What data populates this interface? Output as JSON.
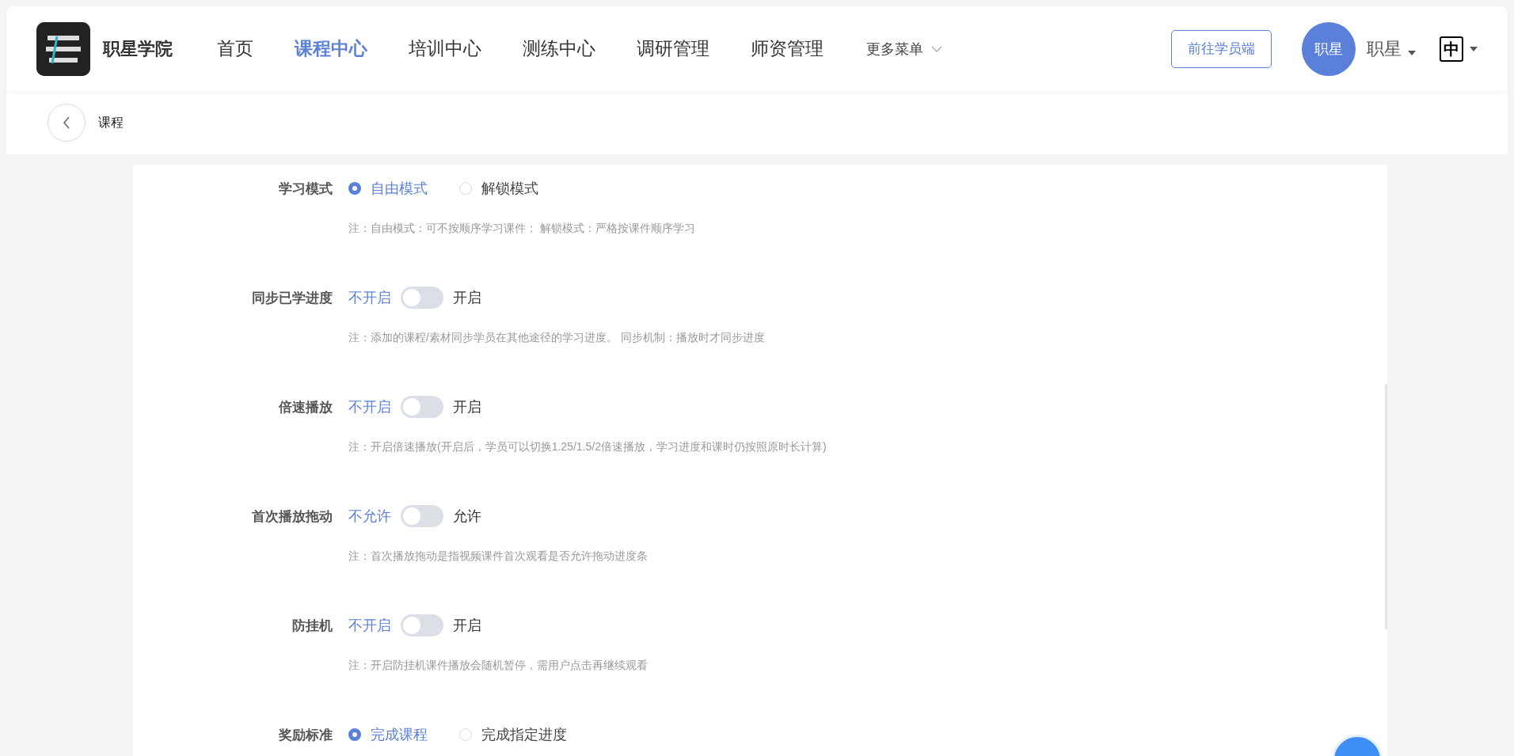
{
  "header": {
    "brand": "职星学院",
    "nav": [
      {
        "label": "首页",
        "selected": false
      },
      {
        "label": "课程中心",
        "selected": true
      },
      {
        "label": "培训中心",
        "selected": false
      },
      {
        "label": "测练中心",
        "selected": false
      },
      {
        "label": "调研管理",
        "selected": false
      },
      {
        "label": "师资管理",
        "selected": false
      }
    ],
    "more_menu": "更多菜单",
    "student_button": "前往学员端",
    "avatar": "职星",
    "user_name": "职星",
    "language": "中"
  },
  "breadcrumb": {
    "title": "课程"
  },
  "settings": [
    {
      "kind": "radio",
      "label": "学习模式",
      "options": [
        {
          "label": "自由模式",
          "selected": true
        },
        {
          "label": "解锁模式",
          "selected": false
        }
      ],
      "note": "注：自由模式：可不按顺序学习课件；  解锁模式：严格按课件顺序学习"
    },
    {
      "kind": "switch",
      "label": "同步已学进度",
      "off_label": "不开启",
      "on_label": "开启",
      "on": false,
      "note": "注：添加的课程/素材同步学员在其他途径的学习进度。 同步机制：播放时才同步进度"
    },
    {
      "kind": "switch",
      "label": "倍速播放",
      "off_label": "不开启",
      "on_label": "开启",
      "on": false,
      "note": "注：开启倍速播放(开启后，学员可以切换1.25/1.5/2倍速播放，学习进度和课时仍按照原时长计算)"
    },
    {
      "kind": "switch",
      "label": "首次播放拖动",
      "off_label": "不允许",
      "on_label": "允许",
      "on": false,
      "note": "注：首次播放拖动是指视频课件首次观看是否允许拖动进度条"
    },
    {
      "kind": "switch",
      "label": "防挂机",
      "off_label": "不开启",
      "on_label": "开启",
      "on": false,
      "note": "注：开启防挂机课件播放会随机暂停，需用户点击再继续观看"
    },
    {
      "kind": "radio",
      "label": "奖励标准",
      "options": [
        {
          "label": "完成课程",
          "selected": true
        },
        {
          "label": "完成指定进度",
          "selected": false
        }
      ]
    }
  ]
}
